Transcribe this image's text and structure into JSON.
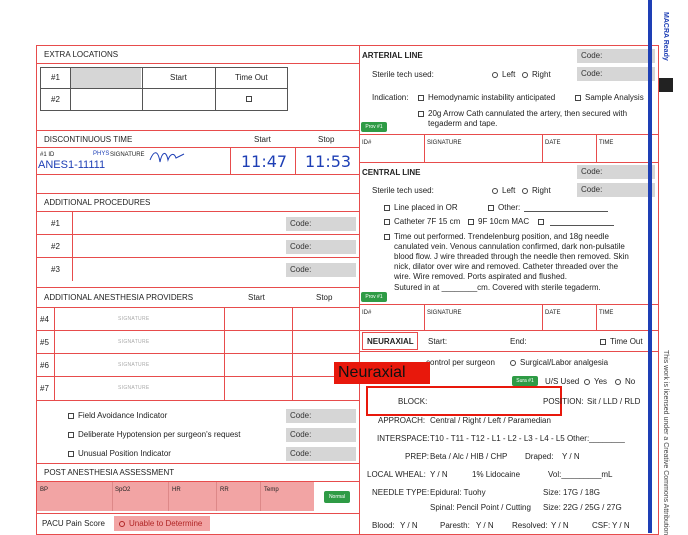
{
  "left": {
    "extra_locations": {
      "title": "EXTRA LOCATIONS",
      "start": "Start",
      "time_out": "Time Out",
      "rows": [
        "#1",
        "#2"
      ]
    },
    "discontinuous": {
      "title": "DISCONTINUOUS TIME",
      "start": "Start",
      "stop": "Stop",
      "id_label": "#1 ID",
      "phys": "PHYS",
      "sig_label": "SIGNATURE",
      "id_value": "ANES1-11111",
      "start_time": "11:47",
      "stop_time": "11:53"
    },
    "additional_procedures": {
      "title": "ADDITIONAL PROCEDURES",
      "rows": [
        "#1",
        "#2",
        "#3"
      ],
      "code": "Code:"
    },
    "providers": {
      "title": "ADDITIONAL ANESTHESIA PROVIDERS",
      "start": "Start",
      "stop": "Stop",
      "rows": [
        "#4",
        "#5",
        "#6",
        "#7"
      ],
      "signature": "SIGNATURE"
    },
    "indicators": [
      {
        "label": "Field Avoidance Indicator",
        "code": "Code:"
      },
      {
        "label": "Deliberate Hypotension per surgeon's request",
        "code": "Code:"
      },
      {
        "label": "Unusual Position Indicator",
        "code": "Code:"
      }
    ],
    "post": {
      "title": "POST ANESTHESIA ASSESSMENT",
      "vitals": [
        "BP",
        "SpO2",
        "HR",
        "RR",
        "Temp"
      ],
      "normal": "Normal",
      "pacu": "PACU Pain Score",
      "unable": "Unable to Determine"
    }
  },
  "right": {
    "arterial": {
      "title": "ARTERIAL LINE",
      "code": "Code:",
      "sterile": "Sterile tech used:",
      "left": "Left",
      "right": "Right",
      "indication": "Indication:",
      "hemo": "Hemodynamic instability anticipated",
      "sample": "Sample Analysis",
      "note1": "20g Arrow Cath cannulated the artery, then secured with",
      "note2": "tegaderm and tape.",
      "prov": "Prov #1",
      "cols": [
        "ID#",
        "SIGNATURE",
        "DATE",
        "TIME"
      ]
    },
    "central": {
      "title": "CENTRAL LINE",
      "code": "Code:",
      "sterile": "Sterile tech used:",
      "left": "Left",
      "right": "Right",
      "line_or": "Line placed in OR",
      "other": "Other:",
      "cath": "Catheter 7F 15 cm",
      "mac": "9F 10cm MAC",
      "note": [
        "Time out performed. Trendelenburg position, and 18g needle",
        "canulated vein. Venous cannulation confirmed, dark non-pulsatile",
        "blood flow. J wire threaded through the needle then removed. Skin",
        "nick, dilator over wire and removed. Catheter threaded over the",
        "wire. Wire removed. Ports aspirated and flushed.",
        "Sutured in at ________cm. Covered with sterile tegaderm."
      ],
      "prov": "Prov #1",
      "cols": [
        "ID#",
        "SIGNATURE",
        "DATE",
        "TIME"
      ]
    },
    "neuraxial": {
      "tab": "NEURAXIAL",
      "start": "Start:",
      "end": "End:",
      "time_out": "Time Out",
      "popup": "Neuraxial",
      "control": "control per surgeon",
      "surgical": "Surgical/Labor analgesia",
      "sura": "Sura #1",
      "us_used": "U/S Used",
      "yes": "Yes",
      "no": "No",
      "block": "BLOCK:",
      "position": "POSITION:",
      "position_vals": "Sit / LLD / RLD",
      "approach": "APPROACH:",
      "approach_vals": "Central / Right / Left / Paramedian",
      "interspace": "INTERSPACE:",
      "interspace_vals": "T10 - T11 - T12 - L1 - L2 - L3 - L4 - L5  Other:________",
      "prep": "PREP:",
      "prep_vals": "Beta / Alc / HIB / CHP",
      "draped": "Draped:",
      "draped_vals": "Y / N",
      "wheal": "LOCAL WHEAL:",
      "wheal_yn": "Y / N",
      "lido": "1% Lidocaine",
      "vol": "Vol:_________mL",
      "needle": "NEEDLE TYPE:",
      "epidural": "Epidural: Tuohy",
      "epi_size": "Size: 17G / 18G",
      "spinal": "Spinal: Pencil Point / Cutting",
      "sp_size": "Size: 22G / 25G / 27G",
      "blood": "Blood:",
      "blood_yn": "Y / N",
      "paresth": "Paresth:",
      "paresth_yn": "Y / N",
      "resolved": "Resolved:",
      "resolved_yn": "Y / N",
      "csf": "CSF:",
      "csf_yn": "Y / N"
    }
  },
  "side": {
    "brand": "MACRA Ready",
    "license": "This work is licensed under a Creative Commons Attribution"
  },
  "colors": {
    "border": "#e74c4c",
    "code_bg": "#d6d6d6",
    "pink": "#f2a4a4",
    "green": "#2e9b45",
    "blue": "#1e3fb5"
  }
}
